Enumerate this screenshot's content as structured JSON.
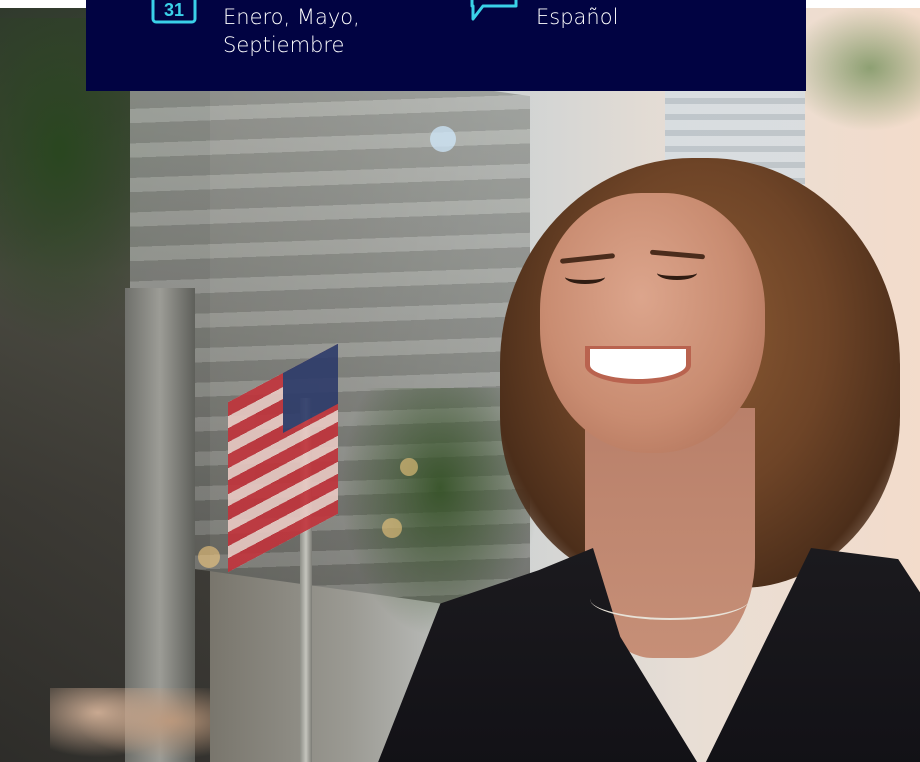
{
  "info_panel": {
    "schedule": {
      "icon": "calendar-icon",
      "calendar_day": "31",
      "months_line1": "Enero, Mayo,",
      "months_line2": "Septiembre"
    },
    "language": {
      "icon": "chat-icon",
      "label": "Español"
    },
    "background_color": "#010342",
    "accent_color": "#3ad1e8"
  },
  "hero": {
    "image": "smiling-woman-outdoors-photo"
  }
}
